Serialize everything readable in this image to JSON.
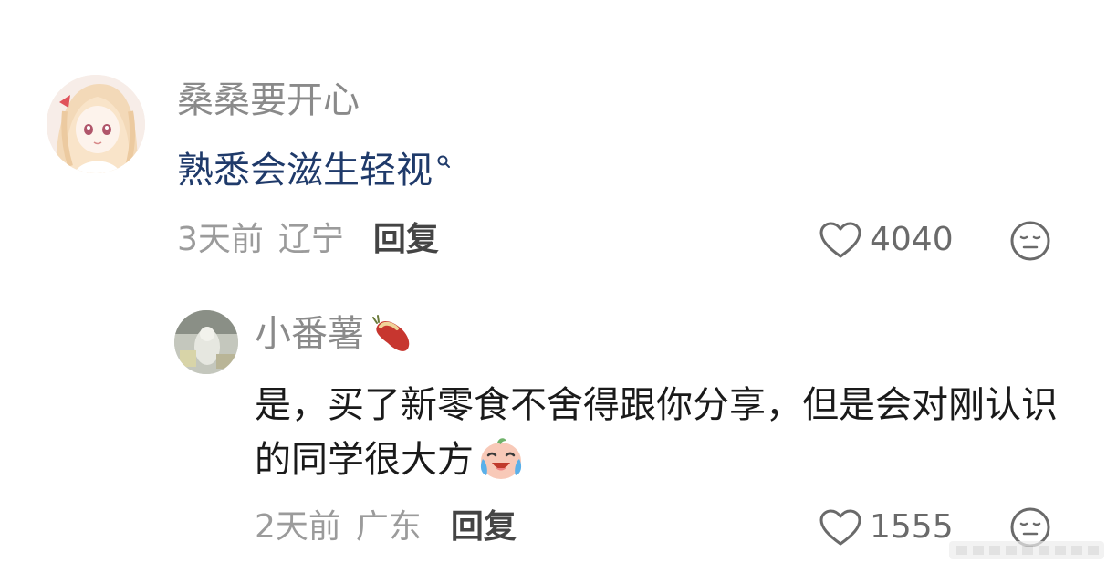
{
  "comments": [
    {
      "username": "桑桑要开心",
      "content": "熟悉会滋生轻视",
      "content_has_search_link": true,
      "time": "3天前",
      "location": "辽宁",
      "reply_label": "回复",
      "likes": "4040",
      "avatar_icon": "anime-girl-avatar",
      "reaction_icon": "neutral-face-icon"
    },
    {
      "username": "小番薯",
      "badge_icon": "sweet-potato-icon",
      "content": "是，买了新零食不舍得跟你分享，但是会对刚认识的同学很大方",
      "content_emoji_icon": "laugh-cry-emoji",
      "time": "2天前",
      "location": "广东",
      "reply_label": "回复",
      "likes": "1555",
      "avatar_icon": "photo-avatar",
      "reaction_icon": "neutral-face-icon"
    }
  ],
  "colors": {
    "username": "#8a8a8a",
    "link_text": "#1f3a6a",
    "body_text": "#1a1a1a",
    "meta": "#9b9b9b",
    "reply_label": "#444444"
  }
}
